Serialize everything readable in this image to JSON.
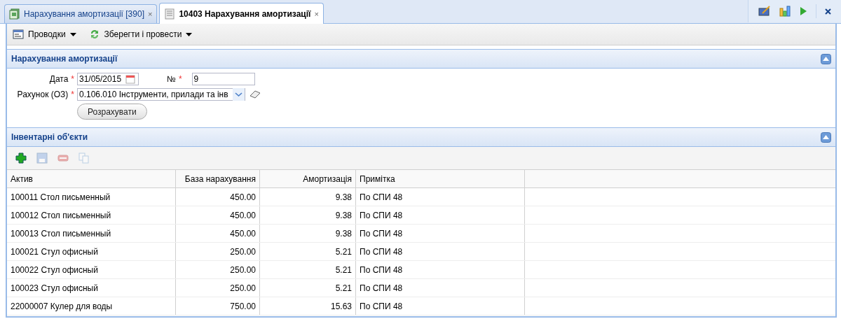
{
  "tabs": [
    {
      "label": "Нарахування амортизації [390]",
      "selected": false,
      "close": "×"
    },
    {
      "label": "10403 Нарахування амортизації",
      "selected": true,
      "close": "×"
    }
  ],
  "toolbar": [
    {
      "label": "Проводки"
    },
    {
      "label": "Зберегти і провести"
    }
  ],
  "header_section": {
    "title": "Нарахування амортизації",
    "expanded": true,
    "date": {
      "label": "Дата",
      "required_mark": "*",
      "value": "31/05/2015"
    },
    "number": {
      "label": "№",
      "required_mark": "*",
      "value": "9"
    },
    "account": {
      "label": "Рахунок (ОЗ)",
      "required_mark": "*",
      "value": "0.106.010 Інструменти, прилади та інв"
    },
    "calculate_button": "Розрахувати"
  },
  "items_section": {
    "title": "Інвентарні об'єкти",
    "expanded": true,
    "tools": [
      {
        "disabled": false
      },
      {
        "disabled": true
      },
      {
        "disabled": true
      },
      {
        "disabled": true
      }
    ],
    "table": {
      "columns": [
        "Актив",
        "База нарахування",
        "Амортизація",
        "Примітка"
      ],
      "rows": [
        [
          "100011 Стол письменный",
          "450.00",
          "9.38",
          "По СПИ 48"
        ],
        [
          "100012 Стол письменный",
          "450.00",
          "9.38",
          "По СПИ 48"
        ],
        [
          "100013 Стол письменный",
          "450.00",
          "9.38",
          "По СПИ 48"
        ],
        [
          "100021 Стул офисный",
          "250.00",
          "5.21",
          "По СПИ 48"
        ],
        [
          "100022 Стул офисный",
          "250.00",
          "5.21",
          "По СПИ 48"
        ],
        [
          "100023 Стул офисный",
          "250.00",
          "5.21",
          "По СПИ 48"
        ],
        [
          "22000007 Кулер для воды",
          "750.00",
          "15.63",
          "По СПИ 48"
        ]
      ]
    }
  }
}
